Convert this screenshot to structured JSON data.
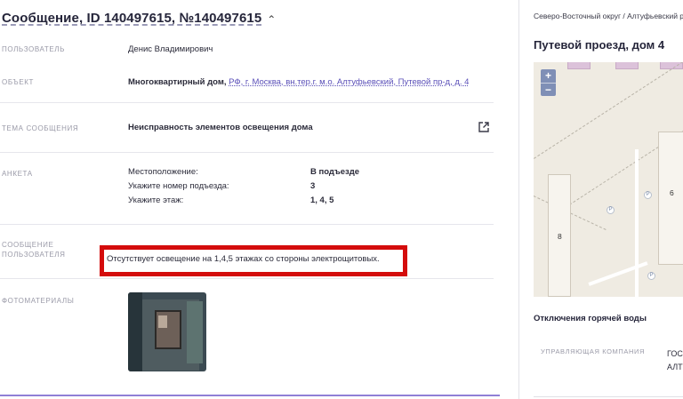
{
  "message": {
    "title": "Сообщение, ID 140497615, №140497615",
    "fields": {
      "user_label": "ПОЛЬЗОВАТЕЛЬ",
      "user_value": "Денис Владимирович",
      "object_label": "ОБЪЕКТ",
      "object_type": "Многоквартирный дом,",
      "object_address": "РФ, г. Москва, вн.тер.г. м.о. Алтуфьевский, Путевой пр-д, д. 4",
      "topic_label": "ТЕМА СООБЩЕНИЯ",
      "topic_value": "Неисправность элементов освещения дома",
      "form_label": "АНКЕТА",
      "user_message_label_1": "СООБЩЕНИЕ",
      "user_message_label_2": "ПОЛЬЗОВАТЕЛЯ",
      "user_message_text": "Отсутствует освещение на 1,4,5 этажах со стороны электрощитовых.",
      "photos_label": "ФОТОМАТЕРИАЛЫ"
    },
    "form": [
      {
        "question": "Местоположение:",
        "answer": "В подъезде"
      },
      {
        "question": "Укажите номер подъезда:",
        "answer": "3"
      },
      {
        "question": "Укажите этаж:",
        "answer": "1, 4, 5"
      }
    ],
    "photos": [
      {
        "icon": "photo-thumbnail"
      }
    ]
  },
  "side": {
    "breadcrumb": "Северо-Восточный округ / Алтуфьевский р",
    "address_title": "Путевой проезд, дом 4",
    "map": {
      "zoom_in": "+",
      "zoom_out": "−",
      "building_labels": [
        "8",
        "6"
      ],
      "poi_label": "P"
    },
    "hot_water_title": "Отключения горячей воды",
    "management_label": "УПРАВЛЯЮЩАЯ КОМПАНИЯ",
    "management_value_1": "ГОСУ",
    "management_value_2": "АЛТУ"
  },
  "colors": {
    "accent": "#5a4fb8",
    "highlight_border": "#d40c0c",
    "bottom_line": "#8f7fd6"
  }
}
